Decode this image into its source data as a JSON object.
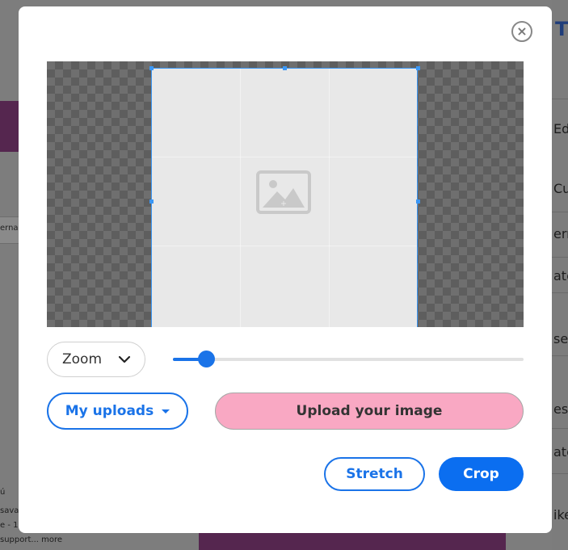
{
  "background": {
    "left_strip_text": "ernar",
    "bottom_left_lines": [
      "ú",
      "savan",
      "e - 1h",
      "support... more"
    ],
    "right_title": "T",
    "right_texts": [
      "Ed",
      "Cu",
      "ern",
      "ate",
      "se",
      "es",
      "ate",
      "ike"
    ]
  },
  "modal": {
    "close_symbol": "×",
    "image_placeholder_icon": "image-placeholder-icon",
    "zoom": {
      "label": "Zoom",
      "chevron_icon": "chevron-down-icon",
      "slider_value_fraction": 0.095
    },
    "uploads_label": "My uploads",
    "upload_image_label": "Upload your image",
    "stretch_label": "Stretch",
    "crop_label": "Crop"
  },
  "colors": {
    "accent": "#1a73e8",
    "crop_button": "#0b6ef0",
    "upload_button": "#f9a8c3",
    "crop_border": "#3b97f5"
  }
}
